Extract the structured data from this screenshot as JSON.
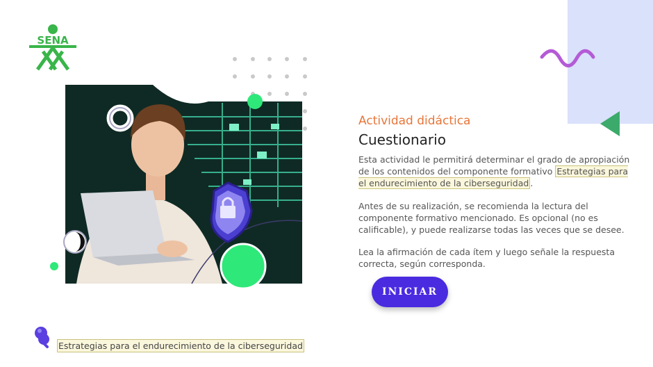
{
  "brand": {
    "logo_text": "SENA",
    "logo_color": "#39b54a"
  },
  "activity": {
    "kicker": "Actividad didáctica",
    "title": "Cuestionario",
    "p1_before": "Esta actividad le permitirá determinar el grado de apropiación de los contenidos del componente formativo ",
    "p1_highlight": "Estrategias para el endurecimiento de la ciberseguridad",
    "p1_after": ".",
    "p2": "Antes de su realización, se recomienda la lectura del componente formativo mencionado.  Es opcional (no es calificable), y puede realizarse todas las veces que se desee.",
    "p3": "Lea la afirmación de cada ítem y luego señale la respuesta correcta, según corresponda.",
    "start_label": "INICIAR"
  },
  "footer": {
    "component_label": "Estrategias para el endurecimiento de la ciberseguridad"
  },
  "colors": {
    "accent_orange": "#e8763a",
    "button": "#4a2be0",
    "green": "#2ee87a",
    "lavender": "#d9e1fb",
    "squiggle": "#b45bd6",
    "highlight_bg": "#fbf7dc"
  },
  "icons": {
    "logo": "sena-logo-icon",
    "squiggle": "wave-decoration-icon",
    "arrow": "triangle-arrow-icon",
    "pin": "pushpin-icon",
    "lock": "shield-lock-icon"
  }
}
